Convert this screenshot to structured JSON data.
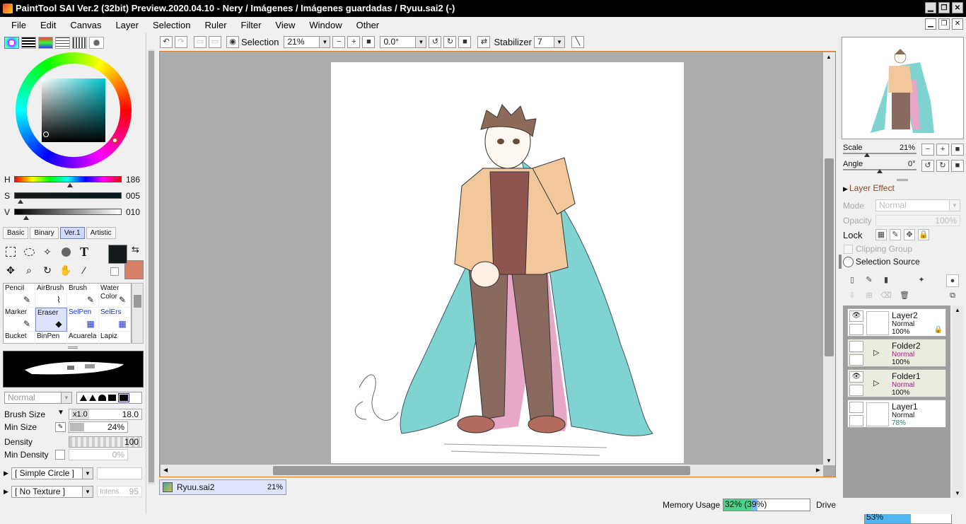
{
  "window": {
    "title": "PaintTool SAI Ver.2 (32bit) Preview.2020.04.10 - Nery / Imágenes / Imágenes guardadas / Ryuu.sai2 (-)"
  },
  "menu": [
    "File",
    "Edit",
    "Canvas",
    "Layer",
    "Selection",
    "Ruler",
    "Filter",
    "View",
    "Window",
    "Other"
  ],
  "colors": {
    "accent": "#e07b20",
    "main_color": "#141a1c",
    "sub_color": "#d68065",
    "selected_tab": "#cfd8ff"
  },
  "color_panel": {
    "h_label": "H",
    "h_value": "186",
    "s_label": "S",
    "s_value": "005",
    "v_label": "V",
    "v_value": "010",
    "tabs": [
      "Basic",
      "Binary",
      "Ver.1",
      "Artistic"
    ],
    "active_tab": "Ver.1"
  },
  "tools": {
    "text_tool": "T"
  },
  "brushes": [
    {
      "label": "Pencil",
      "icon": "pencil-icon",
      "blue": false
    },
    {
      "label": "AirBrush",
      "icon": "airbrush-icon",
      "blue": false
    },
    {
      "label": "Brush",
      "icon": "brush-icon",
      "blue": false
    },
    {
      "label": "Water Color",
      "icon": "watercolor-icon",
      "blue": false
    },
    {
      "label": "Marker",
      "icon": "marker-icon",
      "blue": false
    },
    {
      "label": "Eraser",
      "icon": "eraser-icon",
      "blue": false,
      "selected": true
    },
    {
      "label": "SelPen",
      "icon": "selpen-icon",
      "blue": true
    },
    {
      "label": "SelErs",
      "icon": "selers-icon",
      "blue": true
    },
    {
      "label": "Bucket",
      "icon": "bucket-icon",
      "blue": false
    },
    {
      "label": "BinPen",
      "icon": "binpen-icon",
      "blue": false
    },
    {
      "label": "Acuarela",
      "icon": "acuarela-icon",
      "blue": false
    },
    {
      "label": "Lapiz",
      "icon": "lapiz-icon",
      "blue": false
    }
  ],
  "brush_settings": {
    "blend_mode": "Normal",
    "brush_size_label": "Brush Size",
    "brush_size_mult": "x1.0",
    "brush_size_value": "18.0",
    "min_size_label": "Min Size",
    "min_size_value": "24%",
    "min_size_fraction": 0.24,
    "density_label": "Density",
    "density_value": "100",
    "min_density_label": "Min Density",
    "min_density_value": "0%",
    "shape": "[ Simple Circle ]",
    "texture": "[ No Texture ]",
    "intensity_label": "Intens.",
    "intensity_value": "95"
  },
  "toolbar": {
    "selection_label": "Selection",
    "zoom_value": "21%",
    "rotation_value": "0.0°",
    "stabilizer_label": "Stabilizer",
    "stabilizer_value": "7"
  },
  "document_tab": {
    "name": "Ryuu.sai2",
    "zoom": "21%"
  },
  "status": {
    "memory_label": "Memory Usage",
    "memory_value": "32% (39%)",
    "memory_fraction": 0.39,
    "drive_label": "Drive Usage",
    "drive_value": "53%",
    "drive_fraction": 0.53
  },
  "navigator": {
    "scale_label": "Scale",
    "scale_value": "21%",
    "angle_label": "Angle",
    "angle_value": "0°"
  },
  "layer_props": {
    "layer_effect_label": "Layer Effect",
    "mode_label": "Mode",
    "mode_value": "Normal",
    "opacity_label": "Opacity",
    "opacity_value": "100%",
    "lock_label": "Lock",
    "clipping_label": "Clipping Group",
    "selection_source_label": "Selection Source"
  },
  "layers": [
    {
      "name": "Layer2",
      "mode": "Normal",
      "opacity": "100%",
      "type": "layer",
      "visible": true,
      "locked": true
    },
    {
      "name": "Folder2",
      "mode": "Normal",
      "opacity": "100%",
      "type": "folder",
      "visible": false
    },
    {
      "name": "Folder1",
      "mode": "Normal",
      "opacity": "100%",
      "type": "folder",
      "visible": true
    },
    {
      "name": "Layer1",
      "mode": "Normal",
      "opacity": "78%",
      "type": "layer",
      "visible": false
    }
  ]
}
